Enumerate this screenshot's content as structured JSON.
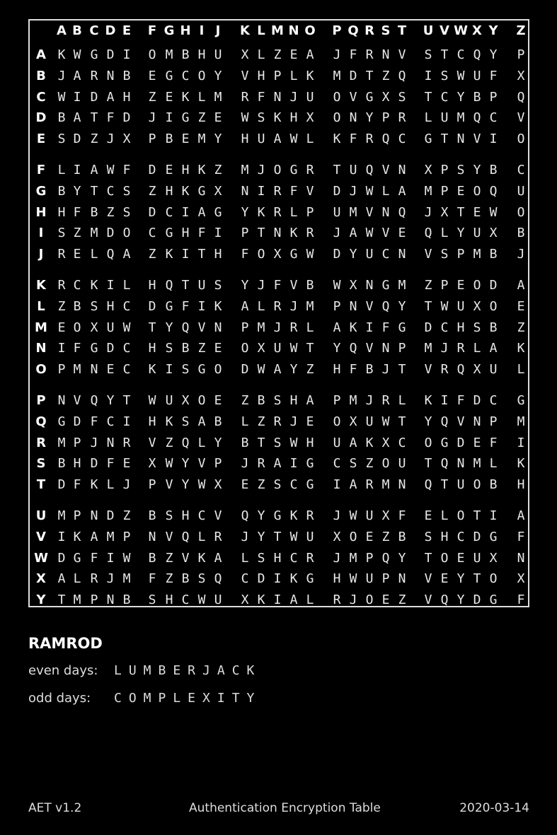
{
  "columns": [
    "A",
    "B",
    "C",
    "D",
    "E",
    "F",
    "G",
    "H",
    "I",
    "J",
    "K",
    "L",
    "M",
    "N",
    "O",
    "P",
    "Q",
    "R",
    "S",
    "T",
    "U",
    "V",
    "W",
    "X",
    "Y",
    "Z"
  ],
  "rows": [
    {
      "label": "A",
      "cells": "KWGDIOMBHUXLZEAJFRNVSTCQYP"
    },
    {
      "label": "B",
      "cells": "JARNBEGCOYVHPLKMDTZQISWUFX"
    },
    {
      "label": "C",
      "cells": "WIDAHZEKLMRFNJUOVGXSTCYBPQ"
    },
    {
      "label": "D",
      "cells": "BATFDJIGZEWSKHXONYPRLUMQCV"
    },
    {
      "label": "E",
      "cells": "SDZJXPBEMYHUAWLKFRQCGTNVIO"
    },
    {
      "label": "F",
      "cells": "LIAWFDEHKZMJOGRTUQVNXPSYBC"
    },
    {
      "label": "G",
      "cells": "BYTCSZHKGXNIRFVDJWLAMPEOQU"
    },
    {
      "label": "H",
      "cells": "HFBZSDCIAGYKRLPUMVNQJXTEWO"
    },
    {
      "label": "I",
      "cells": "SZMDOCGHFIPTNKRJAWVEQLYUXB"
    },
    {
      "label": "J",
      "cells": "RELQAZKITHFOXGWDYUCNVSPMBJ"
    },
    {
      "label": "K",
      "cells": "RCKILHQTUSYJFVBWXNGMZPEODA"
    },
    {
      "label": "L",
      "cells": "ZBSHCDGFIKALRJMPNVQYTWUXOE"
    },
    {
      "label": "M",
      "cells": "EOXUWTYQVNPMJRLAKIFGDCHSBZ"
    },
    {
      "label": "N",
      "cells": "IFGDCHSBZEOXUWTYQVNPMJRLAK"
    },
    {
      "label": "O",
      "cells": "PMNECKISGODWAYZHFBJTVRQXUL"
    },
    {
      "label": "P",
      "cells": "NVQYTWUXOEZBSHAPMJRLKIFDCG"
    },
    {
      "label": "Q",
      "cells": "GDFCIHKSABLZRJEOXUWTYQVNPM"
    },
    {
      "label": "R",
      "cells": "MPJNRVZQLYBTSWHUAKXCOGDEFI"
    },
    {
      "label": "S",
      "cells": "BHDFEXWYVPJRAIGCSZOUTQNMLK"
    },
    {
      "label": "T",
      "cells": "DFKLJPVYWXEZSCGIARMNQTUOBH"
    },
    {
      "label": "U",
      "cells": "MPNDZBSHCVQYGKRJWUXFELOTIA"
    },
    {
      "label": "V",
      "cells": "IKAMPNVQLRJYTWUXOEZBSHCDGF"
    },
    {
      "label": "W",
      "cells": "DGFIWBZVKALSHCRJMPQYTOEUXN"
    },
    {
      "label": "X",
      "cells": "ALRJMFZBSQCDIKGHWUPNVEYTOX"
    },
    {
      "label": "Y",
      "cells": "TMPNBSHCWUXKIALRJOEZVQYDGF"
    }
  ],
  "code": {
    "title": "RAMROD",
    "even_label": "even days:",
    "even_value": "LUMBERJACK",
    "odd_label": "odd days:",
    "odd_value": "COMPLEXITY"
  },
  "footer": {
    "left": "AET v1.2",
    "center": "Authentication Encryption Table",
    "right": "2020-03-14"
  }
}
